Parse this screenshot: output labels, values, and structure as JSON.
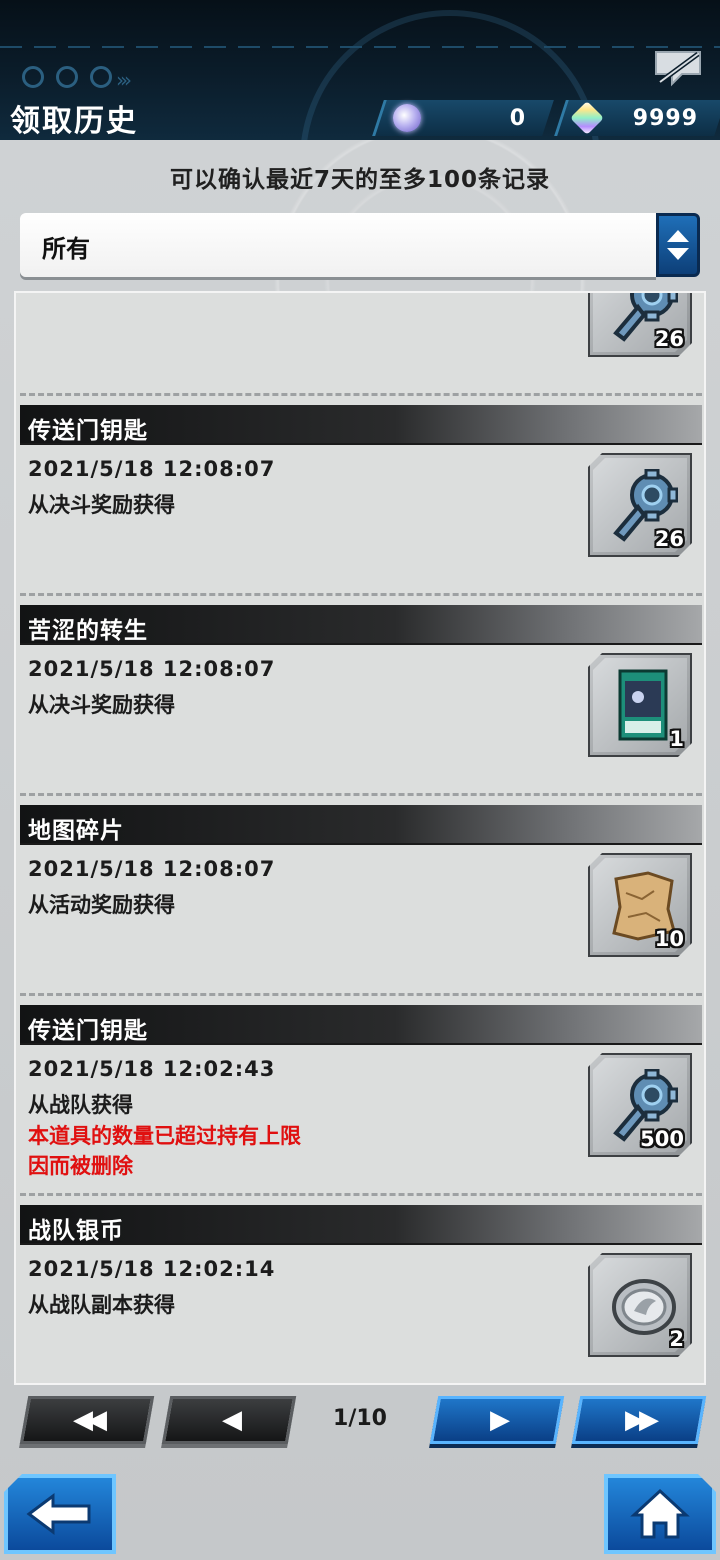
{
  "header": {
    "title": "领取历史",
    "currency_orb": {
      "icon": "orb-gem-icon",
      "value": "0"
    },
    "currency_crystal": {
      "icon": "crystal-gem-icon",
      "value": "9999"
    },
    "chat_icon": "chat-off-icon"
  },
  "subtitle": "可以确认最近7天的至多100条记录",
  "filter": {
    "selected": "所有"
  },
  "entries": [
    {
      "name": "",
      "date": "",
      "source": "",
      "warning": "",
      "icon": "portal-key-icon",
      "qty": "26"
    },
    {
      "name": "传送门钥匙",
      "date": "2021/5/18 12:08:07",
      "source": "从决斗奖励获得",
      "warning": "",
      "icon": "portal-key-icon",
      "qty": "26"
    },
    {
      "name": "苦涩的转生",
      "date": "2021/5/18 12:08:07",
      "source": "从决斗奖励获得",
      "warning": "",
      "icon": "card-icon",
      "qty": "1"
    },
    {
      "name": "地图碎片",
      "date": "2021/5/18 12:08:07",
      "source": "从活动奖励获得",
      "warning": "",
      "icon": "map-fragment-icon",
      "qty": "10"
    },
    {
      "name": "传送门钥匙",
      "date": "2021/5/18 12:02:43",
      "source": "从战队获得",
      "warning": "本道具的数量已超过持有上限\n因而被删除",
      "icon": "portal-key-icon",
      "qty": "500"
    },
    {
      "name": "战队银币",
      "date": "2021/5/18 12:02:14",
      "source": "从战队副本获得",
      "warning": "",
      "icon": "silver-coin-icon",
      "qty": "2"
    }
  ],
  "pagination": {
    "first_glyph": "◀◀",
    "prev_glyph": "◀",
    "next_glyph": "▶",
    "last_glyph": "▶▶",
    "indicator": "1/10"
  },
  "colors": {
    "warning": "#e01010",
    "accent_blue": "#1f76c9"
  }
}
